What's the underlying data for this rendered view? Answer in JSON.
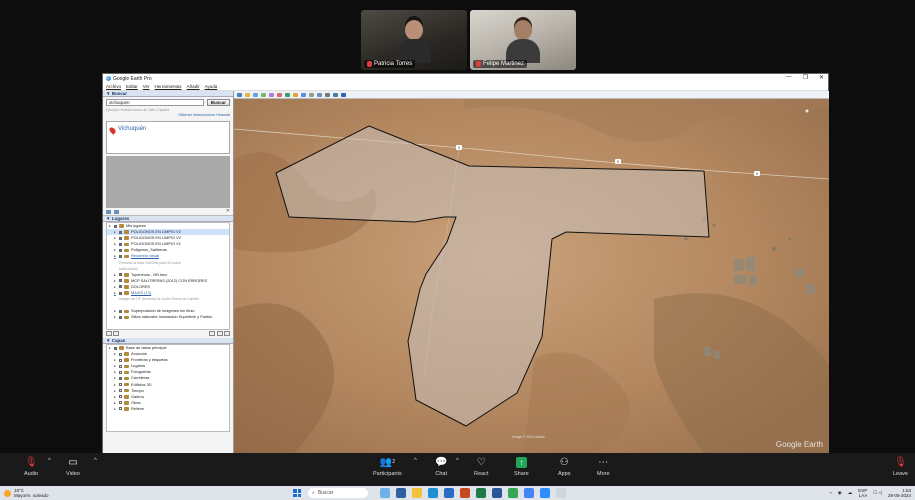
{
  "meeting": {
    "participants": [
      {
        "name": "Patricia Torres",
        "muted": true
      },
      {
        "name": "Felipe Martinez",
        "muted": true
      }
    ]
  },
  "google_earth": {
    "title": "Google Earth Pro",
    "window_controls": [
      "—",
      "❐",
      "✕"
    ],
    "menu": [
      "Archivo",
      "Editar",
      "Ver",
      "Herramientas",
      "Añadir",
      "Ayuda"
    ],
    "search": {
      "panel_title": "▼ Buscar",
      "value": "vichuquen",
      "button": "Buscar",
      "hint": "Ejemplo: Hoteles cerca de Jaén, España",
      "links": "Obtener instrucciones  Historial",
      "result": "Vichuquén"
    },
    "places": {
      "panel_title": "▼ Lugares",
      "rows": [
        {
          "label": "Mis lugares",
          "indent": 0,
          "type": "folder",
          "checked": true
        },
        {
          "label": "POLIGONOS EN LIMPIO V2",
          "indent": 1,
          "type": "folder",
          "checked": true,
          "selected": true
        },
        {
          "label": "POLIGONOS EN LIMPIO V2",
          "indent": 1,
          "type": "folder",
          "checked": true
        },
        {
          "label": "POLIGONOS EN LIMPIO V1",
          "indent": 1,
          "type": "folder",
          "checked": true
        },
        {
          "label": "Poligonos_Salitreras",
          "indent": 1,
          "type": "place",
          "checked": true
        },
        {
          "label": "Recorrido visual",
          "indent": 1,
          "type": "link",
          "checked": true
        },
        {
          "label": "Presione la tecla Ctrl/Cmd para 3D sobre",
          "indent": 2,
          "type": "note"
        },
        {
          "label": "tabla tutorial",
          "indent": 2,
          "type": "note"
        },
        {
          "label": "Topónimos - NR.kmz",
          "indent": 1,
          "type": "place",
          "checked": true
        },
        {
          "label": "MCP SALITRERAS (2012) CON ERRORES",
          "indent": 1,
          "type": "place",
          "checked": true
        },
        {
          "label": "DOLORES",
          "indent": 1,
          "type": "folder",
          "checked": true
        },
        {
          "label": "MAXIS (13)",
          "indent": 1,
          "type": "link",
          "checked": true
        },
        {
          "label": "Imagen de TIF (frontera) de Joahn Seena de Camiña",
          "indent": 2,
          "type": "note"
        },
        {
          "label": "",
          "indent": 2,
          "type": "note"
        },
        {
          "label": "Superposición de imágenes sin título",
          "indent": 1,
          "type": "place",
          "checked": true
        },
        {
          "label": "Sitios naturales Inundación Superficie y Pueblo",
          "indent": 1,
          "type": "place",
          "checked": true
        }
      ]
    },
    "layers": {
      "panel_title": "▼ Capas",
      "rows": [
        {
          "label": "Base de datos principal",
          "indent": 0,
          "checked": true
        },
        {
          "label": "Anuncios",
          "indent": 1,
          "checked": false
        },
        {
          "label": "Fronteras y etiquetas",
          "indent": 1,
          "checked": false
        },
        {
          "label": "Lugares",
          "indent": 1,
          "checked": false
        },
        {
          "label": "Fotografías",
          "indent": 1,
          "checked": false
        },
        {
          "label": "Carreteras",
          "indent": 1,
          "checked": true
        },
        {
          "label": "Edificios 3D",
          "indent": 1,
          "checked": false
        },
        {
          "label": "Tiempo",
          "indent": 1,
          "checked": false
        },
        {
          "label": "Galería",
          "indent": 1,
          "checked": false
        },
        {
          "label": "Otras",
          "indent": 1,
          "checked": false
        },
        {
          "label": "Relieve",
          "indent": 1,
          "checked": false
        }
      ]
    },
    "map": {
      "attribution": "Google Earth",
      "credit": "Image © 2024 Airbus",
      "route_badges": [
        "5",
        "5",
        "5"
      ]
    }
  },
  "zoom_controls": {
    "audio": "Audio",
    "video": "Video",
    "participants": "Participants",
    "participants_count": "2",
    "chat": "Chat",
    "react": "React",
    "share": "Share",
    "apps": "Apps",
    "more": "More",
    "leave": "Leave"
  },
  "taskbar": {
    "temperature": "19°C",
    "weather": "Mayorm. soleado",
    "search_placeholder": "Buscar",
    "lang_1": "ESP",
    "lang_2": "LAA",
    "time": "1:53",
    "date": "28-05-2024"
  },
  "colors": {
    "zoom_bg": "#1a1a1a",
    "share_green": "#21a65a",
    "mic_muted_red": "#e23b3b",
    "polygon_outline": "#111111",
    "desert": "#b58b63"
  }
}
